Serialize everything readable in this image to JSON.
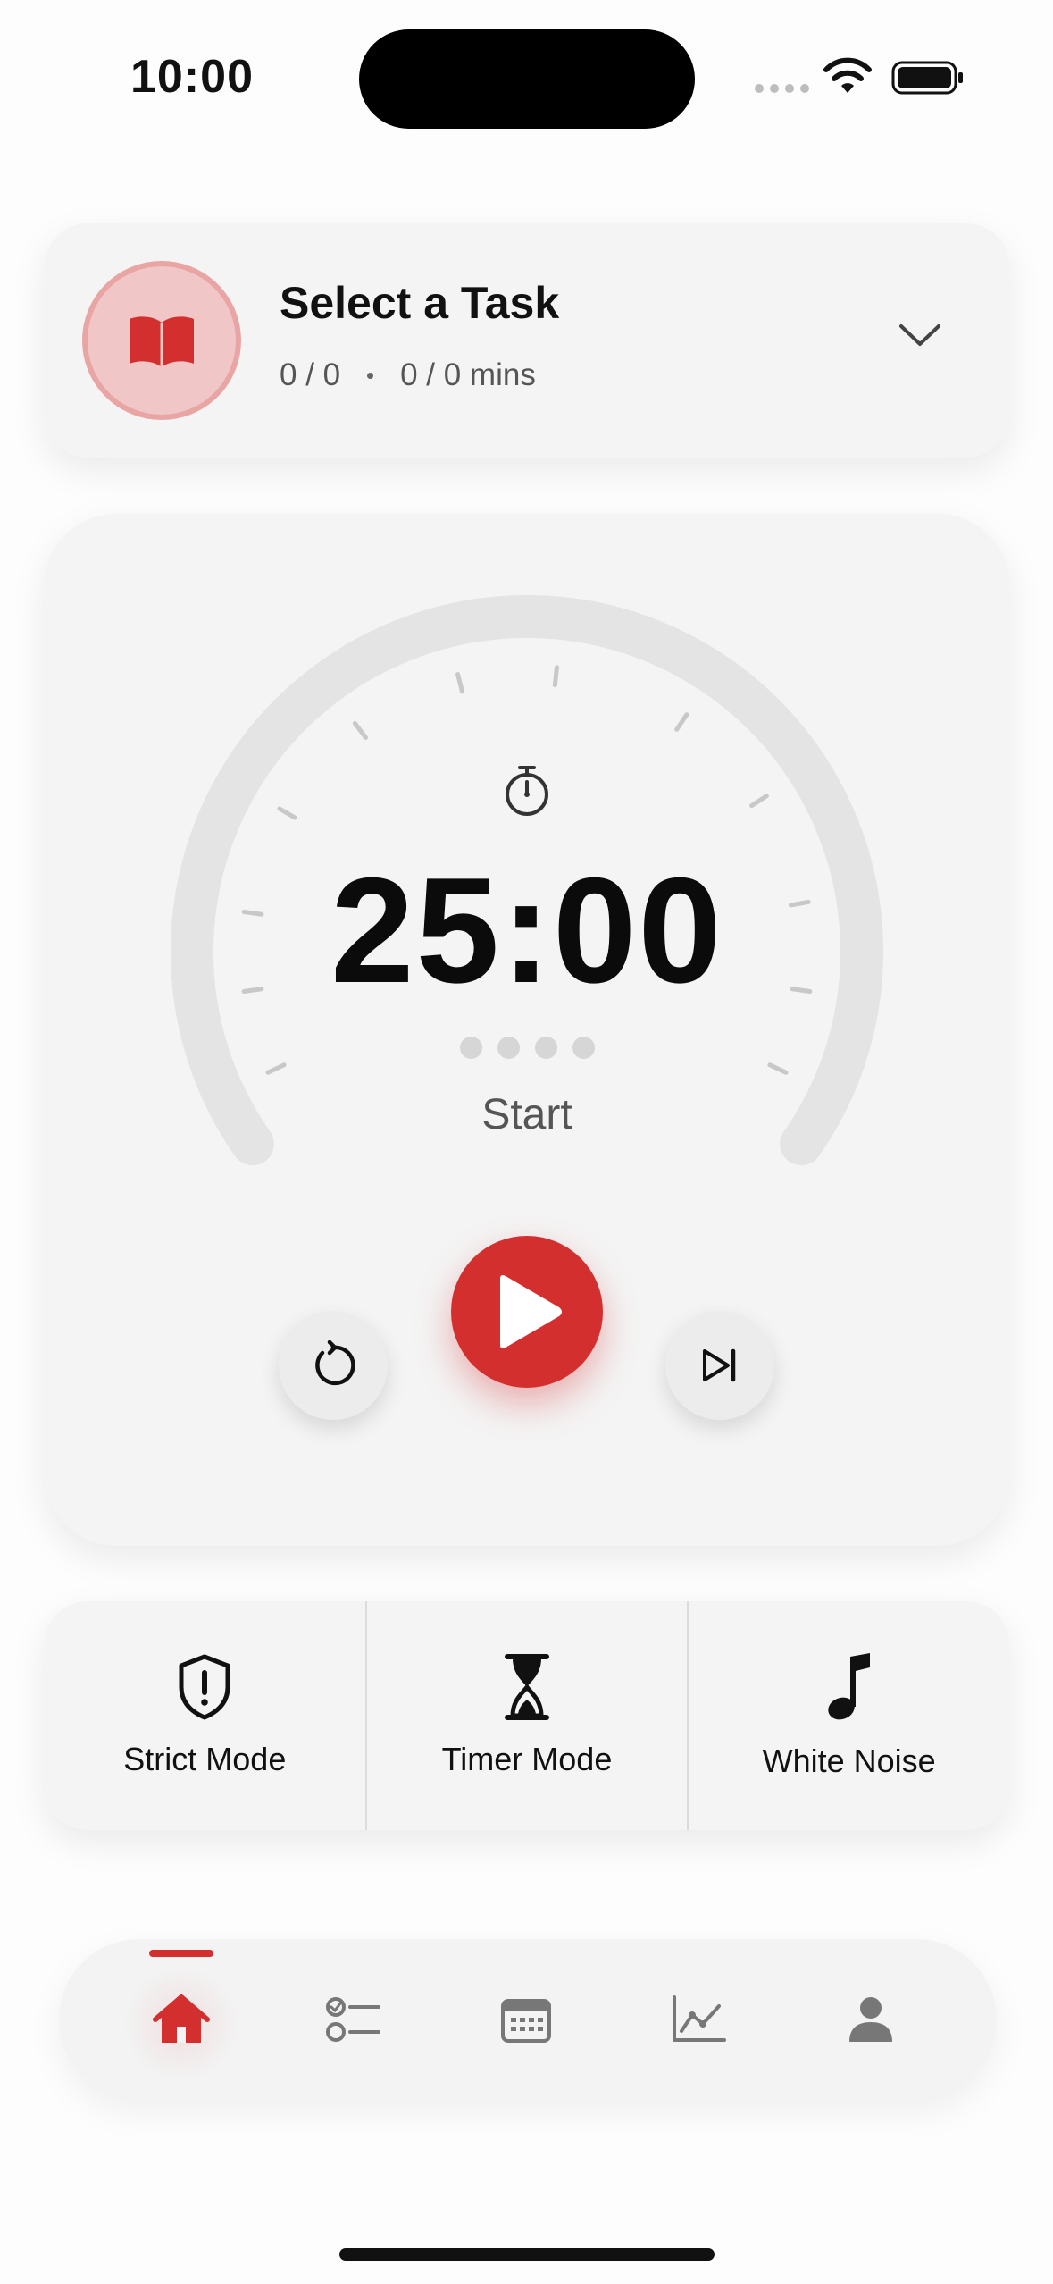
{
  "status_bar": {
    "time": "10:00"
  },
  "task": {
    "title": "Select a Task",
    "count": "0 / 0",
    "minutes": "0 / 0 mins"
  },
  "timer": {
    "time": "25:00",
    "state_label": "Start",
    "sessions_total": 4,
    "sessions_done": 0
  },
  "modes": [
    {
      "label": "Strict Mode",
      "icon": "shield-alert-icon"
    },
    {
      "label": "Timer Mode",
      "icon": "hourglass-icon"
    },
    {
      "label": "White Noise",
      "icon": "music-note-icon"
    }
  ],
  "nav": {
    "active": "home",
    "items": [
      "home-icon",
      "tasks-icon",
      "calendar-icon",
      "stats-icon",
      "profile-icon"
    ]
  },
  "colors": {
    "accent": "#d32f2f",
    "card": "#f4f4f4",
    "track": "#e4e4e4"
  }
}
